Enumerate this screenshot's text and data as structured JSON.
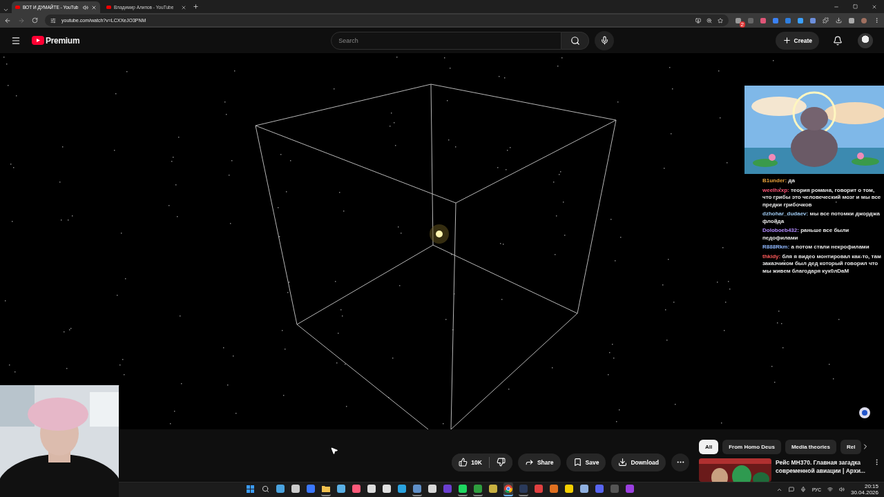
{
  "browser": {
    "tabs": [
      {
        "title": "ВОТ И ДУМАЙТЕ - YouTub",
        "selected": true,
        "audio": true
      },
      {
        "title": "Владимир Алипов - YouTube",
        "selected": false,
        "audio": false
      }
    ],
    "url": "youtube.com/watch?v=LCXXeJO3PNM",
    "extension_badge": "2"
  },
  "header": {
    "logo": "Premium",
    "search": {
      "placeholder": "Search"
    },
    "create": "Create"
  },
  "actions": {
    "likes": "10K",
    "buttons": [
      {
        "kind": "share",
        "label": "Share"
      },
      {
        "kind": "save",
        "label": "Save"
      },
      {
        "kind": "download",
        "label": "Download"
      }
    ]
  },
  "chips": [
    {
      "label": "All",
      "selected": true
    },
    {
      "label": "From Homo Deus",
      "selected": false
    },
    {
      "label": "Media theories",
      "selected": false
    },
    {
      "label": "Rel",
      "selected": false
    }
  ],
  "recommended": [
    {
      "title": "Рейс MH370. Главная загадка современной авиации | Архи..."
    }
  ],
  "chat": [
    {
      "user": "B1under:",
      "color": "#e8a23a",
      "text": "да"
    },
    {
      "user": "weelhxxp:",
      "color": "#ff5577",
      "text": "теория романа, говорит о том, что грибы это человеческий мозг и мы все предки грибочков"
    },
    {
      "user": "dzhohar_dudaev:",
      "color": "#9ec9f0",
      "text": "мы все потомки джорджа флойда"
    },
    {
      "user": "Doloboeb432:",
      "color": "#b48cff",
      "text": "раньше все были педофилами"
    },
    {
      "user": "R888Rkm:",
      "color": "#8fb8ff",
      "text": "а потом стали некрофилами"
    },
    {
      "user": "thkidy:",
      "color": "#ff5a5a",
      "text": "бля я видео монтировал как-то, там заказчиком был дед который говорил что мы живем благодаря кук0лDaM"
    }
  ],
  "taskbar": {
    "apps": [
      {
        "kind": "start",
        "color": "#3b9cff",
        "running": false,
        "selected": false
      },
      {
        "kind": "search",
        "running": false,
        "selected": false
      },
      {
        "kind": "app",
        "color": "#4aa3df",
        "running": false,
        "selected": false
      },
      {
        "kind": "app",
        "color": "#cccccc",
        "running": false,
        "selected": false
      },
      {
        "kind": "app",
        "color": "#3b78ff",
        "running": false,
        "selected": false
      },
      {
        "kind": "folder",
        "color": "#f2c14e",
        "running": true,
        "selected": false
      },
      {
        "kind": "app",
        "color": "#5ab0e6",
        "running": false,
        "selected": false
      },
      {
        "kind": "app",
        "color": "#ff5a7a",
        "running": false,
        "selected": false
      },
      {
        "kind": "app",
        "color": "#dddddd",
        "running": false,
        "selected": false
      },
      {
        "kind": "app",
        "color": "#e0e0e0",
        "running": false,
        "selected": false
      },
      {
        "kind": "app",
        "color": "#2aa3e0",
        "running": false,
        "selected": false
      },
      {
        "kind": "app",
        "color": "#5f8fc8",
        "running": true,
        "selected": false
      },
      {
        "kind": "app",
        "color": "#d8d8d8",
        "running": false,
        "selected": false
      },
      {
        "kind": "app",
        "color": "#6b3fd0",
        "running": false,
        "selected": false
      },
      {
        "kind": "app",
        "color": "#1ed760",
        "running": true,
        "selected": false
      },
      {
        "kind": "app",
        "color": "#2e9e3e",
        "running": true,
        "selected": false
      },
      {
        "kind": "app",
        "color": "#c8b040",
        "running": false,
        "selected": false
      },
      {
        "kind": "chrome",
        "running": true,
        "selected": true
      },
      {
        "kind": "app",
        "color": "#2a3a5a",
        "running": true,
        "selected": false
      },
      {
        "kind": "app",
        "color": "#e04040",
        "running": false,
        "selected": false
      },
      {
        "kind": "app",
        "color": "#e07020",
        "running": false,
        "selected": false
      },
      {
        "kind": "app",
        "color": "#f5d000",
        "running": false,
        "selected": false
      },
      {
        "kind": "app",
        "color": "#8fb0e0",
        "running": false,
        "selected": false
      },
      {
        "kind": "app",
        "color": "#5865f2",
        "running": false,
        "selected": false
      },
      {
        "kind": "app",
        "color": "#555555",
        "running": false,
        "selected": false
      },
      {
        "kind": "app",
        "color": "#9b3fe0",
        "running": false,
        "selected": false
      }
    ],
    "language": "РУС",
    "time": "20:15",
    "date": "30.04.2026"
  }
}
